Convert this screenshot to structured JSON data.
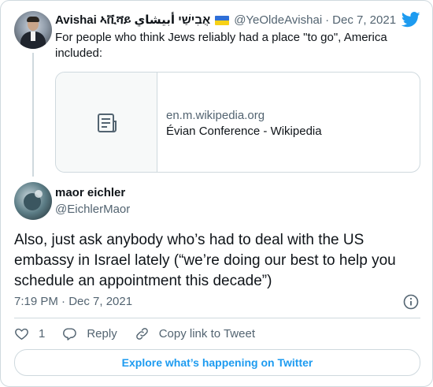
{
  "tweet1": {
    "name": "Avishai ኣቪሻይ אֲבִישַׁי أبيشاي",
    "handle": "@YeOldeAvishai",
    "separator": "·",
    "date": "Dec 7, 2021",
    "text": "For people who think Jews reliably had a place \"to go\", America included:",
    "link_card": {
      "domain": "en.m.wikipedia.org",
      "title": "Évian Conference - Wikipedia",
      "thumb_icon": "document-icon"
    }
  },
  "tweet2": {
    "name": "maor eichler",
    "handle": "@EichlerMaor",
    "text": "Also, just ask anybody who’s had to deal with the US embassy in Israel lately (“we’re doing our best to help you schedule an appointment this decade”)",
    "timestamp": "7:19 PM · Dec 7, 2021"
  },
  "actions": {
    "like_count": "1",
    "reply_label": "Reply",
    "copy_label": "Copy link to Tweet"
  },
  "explore_label": "Explore what’s happening on Twitter",
  "colors": {
    "accent": "#1d9bf0",
    "muted": "#536471",
    "border": "#cfd9de"
  }
}
